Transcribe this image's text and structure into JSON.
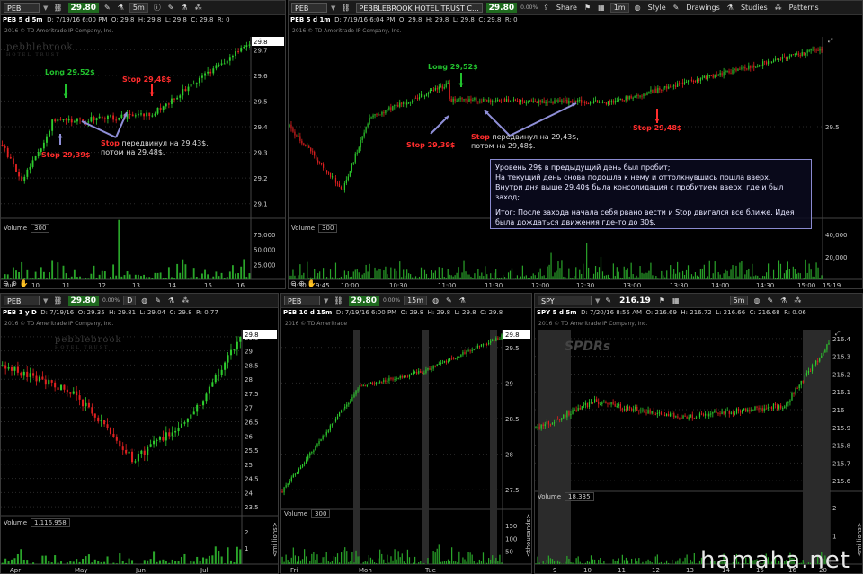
{
  "panels": {
    "p1": {
      "symbol": "PEB 5 d 5m",
      "sym_box": "PEB",
      "price": "29.80",
      "interval": "5m",
      "info": {
        "date": "D: 7/19/16 6:00 PM",
        "o": "O: 29.8",
        "h": "H: 29.8",
        "l": "L: 29.8",
        "c": "C: 29.8",
        "r": "R: 0"
      },
      "copyright": "2016 © TD Ameritrade IP Company, Inc.",
      "logo": "pebblebrook",
      "logo_sub": "HOTEL TRUST",
      "last_price_tag": "29.8",
      "y_ticks": [
        "29.7",
        "29.6",
        "29.5",
        "29.4",
        "29.3",
        "29.2",
        "29.1"
      ],
      "x_ticks": [
        "Tue",
        "10",
        "11",
        "12",
        "13",
        "14",
        "15",
        "16"
      ],
      "volume_label": "Volume",
      "volume_value": "300",
      "vol_ticks": [
        "75,000",
        "50,000",
        "25,000"
      ]
    },
    "p2": {
      "symbol": "PEB 5 d 1m",
      "sym_box": "PEB",
      "sym_desc": "PEBBLEBROOK HOTEL TRUST C...",
      "price": "29.80",
      "pct": "0.00%",
      "toolbar": {
        "share": "Share",
        "interval": "1m",
        "style": "Style",
        "drawings": "Drawings",
        "studies": "Studies",
        "patterns": "Patterns"
      },
      "info": {
        "date": "D: 7/19/16 6:04 PM",
        "o": "O: 29.8",
        "h": "H: 29.8",
        "l": "L: 29.8",
        "c": "C: 29.8",
        "r": "R: 0"
      },
      "copyright": "2016 © TD Ameritrade IP Company, Inc.",
      "y_ticks": [
        "29.5"
      ],
      "x_ticks": [
        "9:30",
        "9:45",
        "10:00",
        "10:30",
        "11:00",
        "11:30",
        "12:00",
        "12:30",
        "13:00",
        "13:30",
        "14:00",
        "14:30",
        "15:00",
        "15:19"
      ],
      "volume_label": "Volume",
      "volume_value": "300",
      "vol_ticks": [
        "40,000",
        "20,000"
      ]
    },
    "p3": {
      "symbol": "PEB 1 y D",
      "sym_box": "PEB",
      "price": "29.80",
      "pct": "0.00%",
      "interval": "D",
      "info": {
        "date": "D: 7/19/16",
        "o": "O: 29.35",
        "h": "H: 29.81",
        "l": "L: 29.04",
        "c": "C: 29.8",
        "r": "R: 0.77"
      },
      "copyright": "2016 © TD Ameritrade IP Company, Inc.",
      "logo": "pebblebrook",
      "logo_sub": "HOTEL TRUST",
      "last_price_tag": "29.8",
      "y_ticks": [
        "29.5",
        "29",
        "28.5",
        "28",
        "27.5",
        "27",
        "26.5",
        "26",
        "25.5",
        "25",
        "24.5",
        "24",
        "23.5"
      ],
      "x_ticks": [
        "Apr",
        "May",
        "Jun",
        "Jul"
      ],
      "volume_label": "Volume",
      "volume_value": "1,116,958",
      "vol_ticks": [
        "2",
        "1"
      ],
      "vol_unit": "<millions>"
    },
    "p4": {
      "symbol": "PEB 10 d 15m",
      "sym_box": "PEB",
      "price": "29.80",
      "pct": "0.00%",
      "interval": "15m",
      "info": {
        "date": "D: 7/19/16 6:00 PM",
        "o": "O: 29.8",
        "h": "H: 29.8",
        "l": "L: 29.8",
        "c": "C: 29.8"
      },
      "copyright": "2016 © TD Ameritrade",
      "last_price_tag": "29.8",
      "y_ticks": [
        "29.5",
        "29",
        "28.5",
        "28",
        "27.5"
      ],
      "x_ticks": [
        "Fri",
        "Mon",
        "Tue"
      ],
      "volume_label": "Volume",
      "volume_value": "300",
      "vol_ticks": [
        "150",
        "100",
        "50"
      ],
      "vol_unit": "<thousands>"
    },
    "p5": {
      "symbol": "SPY 5 d 5m",
      "sym_box": "SPY",
      "price": "216.19",
      "interval": "5m",
      "info": {
        "date": "D: 7/20/16 8:55 AM",
        "o": "O: 216.69",
        "h": "H: 216.72",
        "l": "L: 216.66",
        "c": "C: 216.68",
        "r": "R: 0.06"
      },
      "copyright": "2016 © TD Ameritrade IP Company, Inc.",
      "logo": "SPDRs",
      "y_ticks": [
        "216.4",
        "216.3",
        "216.2",
        "216.1",
        "216",
        "215.9",
        "215.8",
        "215.7",
        "215.6"
      ],
      "x_ticks": [
        "9",
        "10",
        "11",
        "12",
        "13",
        "14",
        "15",
        "16",
        "20"
      ],
      "volume_label": "Volume",
      "volume_value": "18,335",
      "vol_ticks": [
        "2",
        "1"
      ],
      "vol_unit": "<millions>"
    }
  },
  "annotations": {
    "p1_long": "Long 29,52$",
    "p1_stop1": "Stop 29,48$",
    "p1_stop2": "Stop 29,39$",
    "p1_move_a": "Stop",
    "p1_move_b": "передвинул на 29,43$,",
    "p1_move_c": "потом на 29,48$.",
    "p2_long": "Long 29,52$",
    "p2_stop_low": "Stop 29,39$",
    "p2_move_a": "Stop",
    "p2_move_b": "передвинул на 29,43$,",
    "p2_move_c": "потом на 29,48$.",
    "p2_stop_right": "Stop 29,48$"
  },
  "note": {
    "l1": "Уровень 29$ в предыдущий день был пробит;",
    "l2": "На текущий день снова подошла к нему и оттолкнувшись пошла вверх.",
    "l3": "Внутри дня выше 29,40$ была консолидация с пробитием вверх, где и был заход;",
    "l4": "Итог: После захода начала себя рвано вести и Stop двигался все ближе. Идея была дождаться движения где-то до 30$."
  },
  "watermark": "hamaha.net",
  "colors": {
    "up": "#2ecc2e",
    "down": "#e02020",
    "volume": "#2aa52a",
    "bg": "#000000"
  }
}
